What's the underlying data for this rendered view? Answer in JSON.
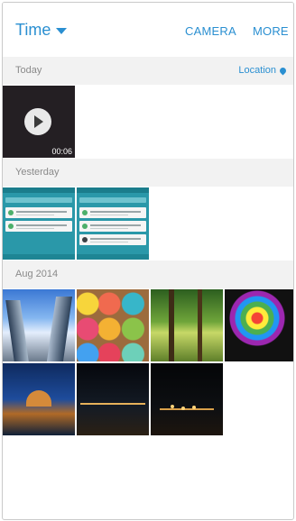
{
  "header": {
    "title": "Time",
    "actions": {
      "camera": "CAMERA",
      "more": "MORE"
    }
  },
  "sections": {
    "today": {
      "label": "Today",
      "location_label": "Location",
      "video": {
        "duration": "00:06"
      }
    },
    "yesterday": {
      "label": "Yesterday"
    },
    "aug2014": {
      "label": "Aug 2014"
    }
  },
  "colors": {
    "accent": "#2a8fd1",
    "section_bg": "#f2f2f2"
  },
  "icons": {
    "title_dropdown": "chevron-down-icon",
    "location": "location-pin-icon",
    "video": "play-icon"
  }
}
